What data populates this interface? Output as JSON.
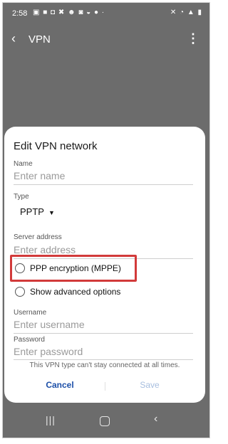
{
  "statusbar": {
    "time": "2:58",
    "left_icons": "▣ ■ ◘ ✖ ☻ ◙ ◒ ● ·",
    "right_icons": "✕ ◔ ▲ ▮"
  },
  "appbar": {
    "title": "VPN",
    "back_icon": "chevron-left-icon",
    "more_icon": "more-vert-icon"
  },
  "dialog": {
    "title": "Edit VPN network",
    "name": {
      "label": "Name",
      "placeholder": "Enter name",
      "value": ""
    },
    "type": {
      "label": "Type",
      "selected": "PPTP"
    },
    "server": {
      "label": "Server address",
      "placeholder": "Enter address",
      "value": ""
    },
    "options": [
      {
        "label": "PPP encryption (MPPE)",
        "checked": false
      },
      {
        "label": "Show advanced options",
        "checked": false
      }
    ],
    "username": {
      "label": "Username",
      "placeholder": "Enter username",
      "value": ""
    },
    "password": {
      "label": "Password",
      "placeholder": "Enter password",
      "value": ""
    },
    "hint": "This VPN type can't stay connected at all times.",
    "cancel_label": "Cancel",
    "save_label": "Save"
  },
  "colors": {
    "highlight": "#d23a3a",
    "cancel": "#1c4fa8",
    "save_disabled": "#a7bedf",
    "backdrop": "#6c6c6c"
  },
  "navbar": {
    "recent_icon": "recent-apps-icon",
    "home_icon": "home-icon",
    "back_icon": "back-icon"
  }
}
